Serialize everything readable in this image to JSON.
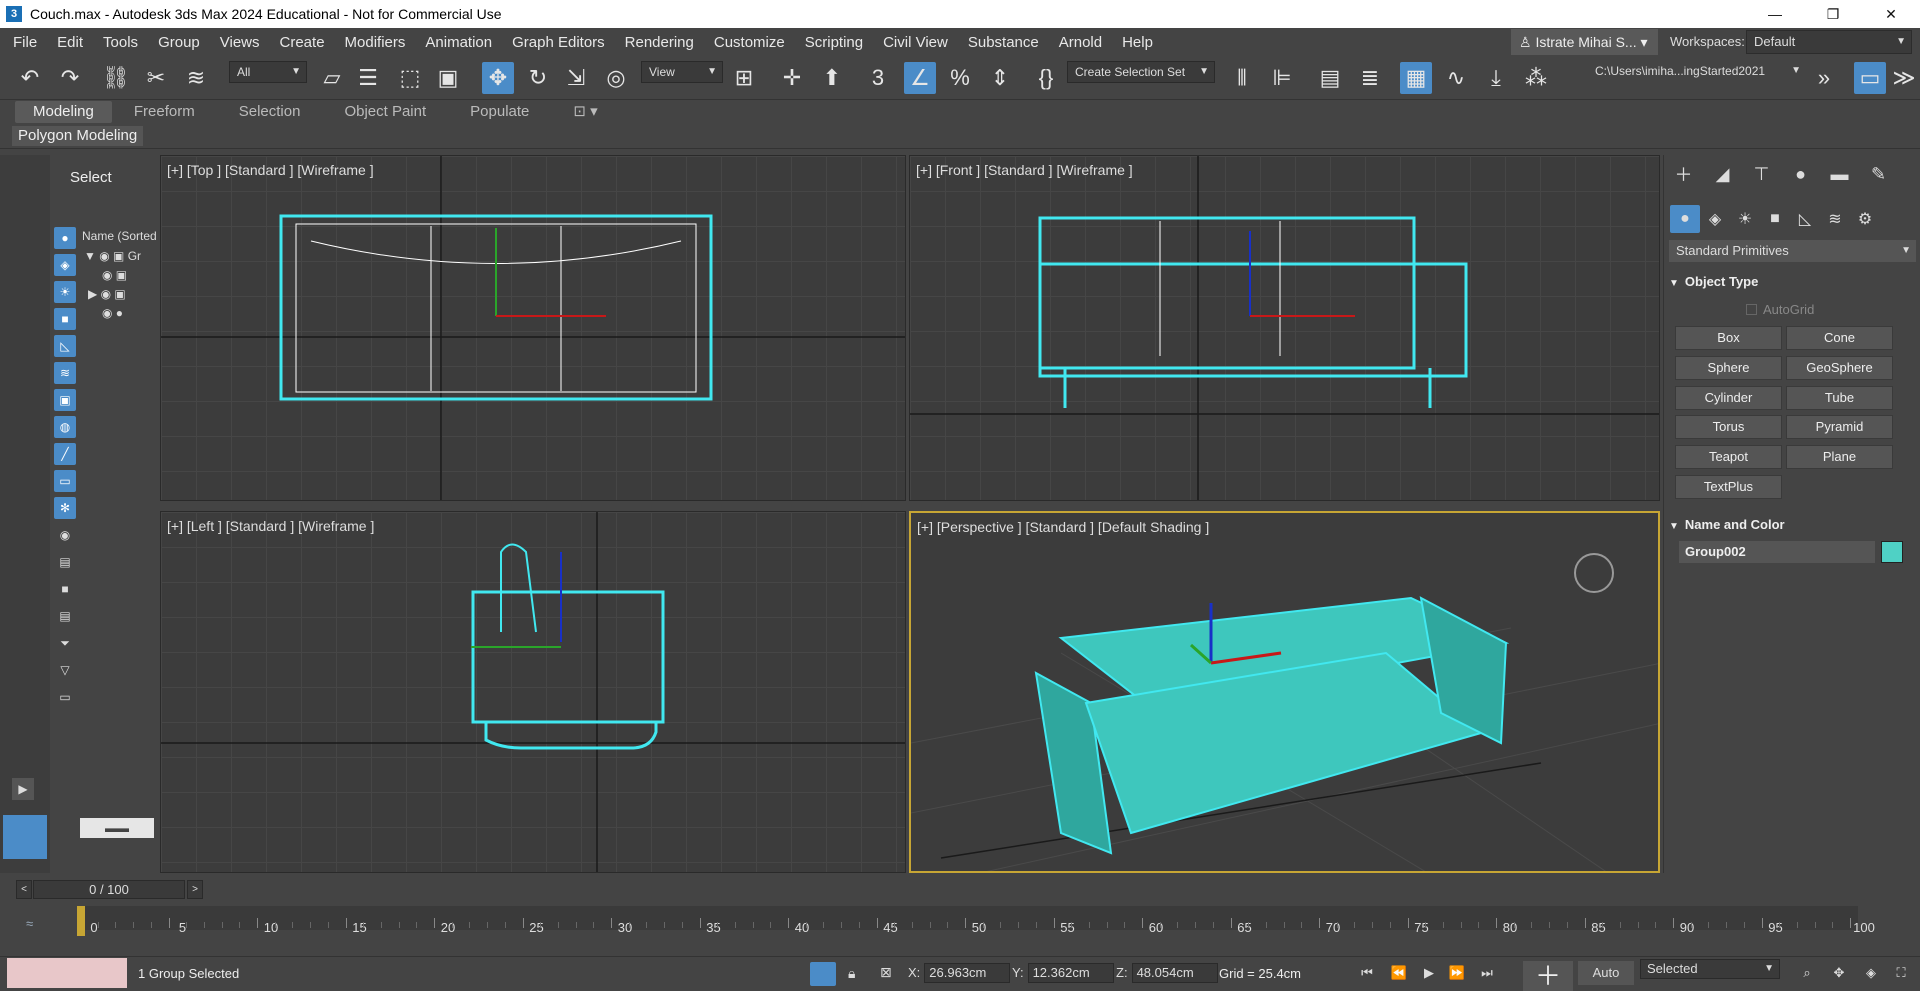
{
  "window": {
    "title": "Couch.max - Autodesk 3ds Max 2024 Educational - Not for Commercial Use",
    "app_icon": "3",
    "controls": [
      "—",
      "❐",
      "✕"
    ]
  },
  "menu": [
    "File",
    "Edit",
    "Tools",
    "Group",
    "Views",
    "Create",
    "Modifiers",
    "Animation",
    "Graph Editors",
    "Rendering",
    "Customize",
    "Scripting",
    "Civil View",
    "Substance",
    "Arnold",
    "Help"
  ],
  "user": {
    "name": "Istrate Mihai S...",
    "dropdown": "▾"
  },
  "workspaces": {
    "label": "Workspaces:",
    "value": "Default"
  },
  "toolbar": {
    "filter_value": "All",
    "refcoord_value": "View",
    "selection_set": "Create Selection Set",
    "project_path": "C:\\Users\\imiha...ingStarted2021",
    "overflow": "»"
  },
  "ribbon": {
    "tabs": [
      "Modeling",
      "Freeform",
      "Selection",
      "Object Paint",
      "Populate"
    ],
    "active_tab": "Modeling",
    "panel_label": "Polygon Modeling"
  },
  "explorer": {
    "select_label": "Select",
    "column_header": "Name (Sorted Ascending)",
    "row_label": "Gr",
    "bottom_box": "▬▬"
  },
  "viewports": {
    "top": {
      "label": "[+] [Top ] [Standard ] [Wireframe ]"
    },
    "front": {
      "label": "[+] [Front ] [Standard ] [Wireframe ]"
    },
    "left": {
      "label": "[+] [Left ] [Standard ] [Wireframe ]"
    },
    "perspective": {
      "label": "[+] [Perspective ] [Standard ] [Default Shading ]"
    },
    "couch_color": "#3ec7bd",
    "selection_color": "#41e8f0",
    "active_border": "#c7a634",
    "axis_labels": {
      "x": "x",
      "y": "y",
      "z": "z"
    }
  },
  "command_panel": {
    "category": "Standard Primitives",
    "object_type_title": "Object Type",
    "autogrid": "AutoGrid",
    "buttons": [
      "Box",
      "Cone",
      "Sphere",
      "GeoSphere",
      "Cylinder",
      "Tube",
      "Torus",
      "Pyramid",
      "Teapot",
      "Plane",
      "TextPlus"
    ],
    "name_color_title": "Name and Color",
    "object_name": "Group002",
    "object_color": "#4fd1c5"
  },
  "timeline": {
    "frame_display": "0 / 100",
    "prev": "<",
    "next": ">",
    "ticks": [
      "0",
      "5",
      "10",
      "15",
      "20",
      "25",
      "30",
      "35",
      "40",
      "45",
      "50",
      "55",
      "60",
      "65",
      "70",
      "75",
      "80",
      "85",
      "90",
      "95",
      "100"
    ]
  },
  "status": {
    "selection_text": "1 Group Selected",
    "x_label": "X:",
    "x_value": "26.963cm",
    "y_label": "Y:",
    "y_value": "12.362cm",
    "z_label": "Z:",
    "z_value": "48.054cm",
    "grid": "Grid = 25.4cm",
    "auto_key": "Auto",
    "selected_set": "Selected"
  }
}
